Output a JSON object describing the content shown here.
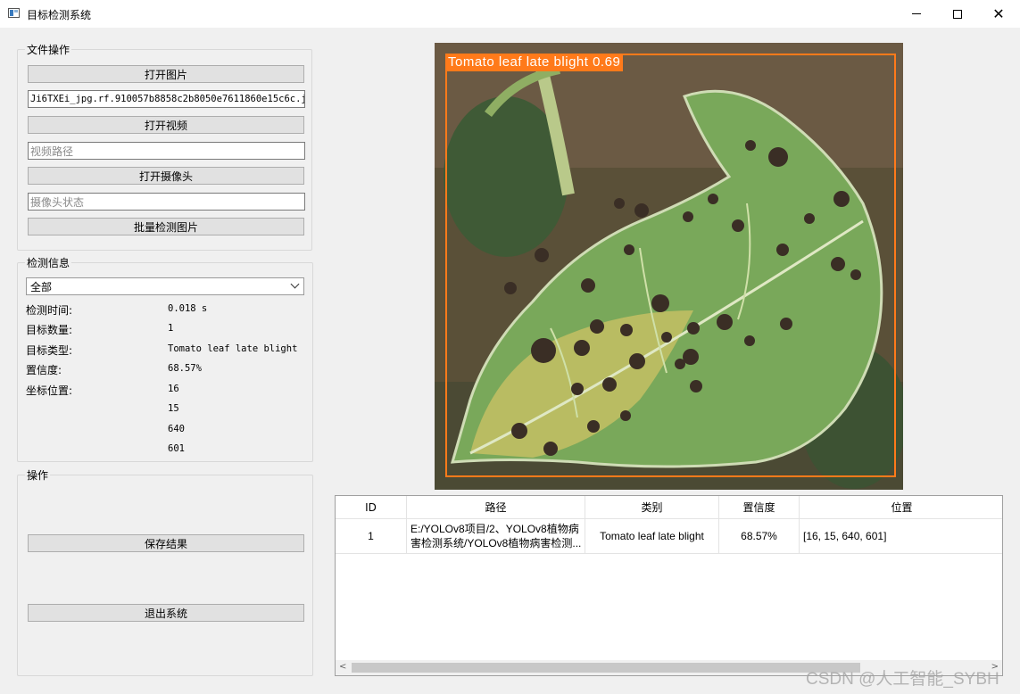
{
  "window": {
    "title": "目标检测系统"
  },
  "file_ops": {
    "title": "文件操作",
    "open_image": "打开图片",
    "image_path": "Ji6TXEi_jpg.rf.910057b8858c2b8050e7611860e15c6c.jpg",
    "open_video": "打开视频",
    "video_placeholder": "视频路径",
    "open_camera": "打开摄像头",
    "camera_placeholder": "摄像头状态",
    "batch_detect": "批量检测图片"
  },
  "detect_info": {
    "title": "检测信息",
    "select_value": "全部",
    "time_label": "检测时间:",
    "time_value": "0.018 s",
    "count_label": "目标数量:",
    "count_value": "1",
    "type_label": "目标类型:",
    "type_value": "Tomato leaf late blight",
    "conf_label": "置信度:",
    "conf_value": "68.57%",
    "coord_label": "坐标位置:",
    "coords": [
      "16",
      "15",
      "640",
      "601"
    ]
  },
  "operations": {
    "title": "操作",
    "save": "保存结果",
    "exit": "退出系统"
  },
  "detection": {
    "label": "Tomato leaf late blight 0.69",
    "box_color": "#ff7a1a"
  },
  "table": {
    "headers": [
      "ID",
      "路径",
      "类别",
      "置信度",
      "位置"
    ],
    "rows": [
      {
        "id": "1",
        "path": "E:/YOLOv8项目/2、YOLOv8植物病害检测系统/YOLOv8植物病害检测...",
        "class": "Tomato leaf late blight",
        "confidence": "68.57%",
        "position": "[16, 15, 640, 601]"
      }
    ]
  },
  "watermark": "CSDN @人工智能_SYBH"
}
